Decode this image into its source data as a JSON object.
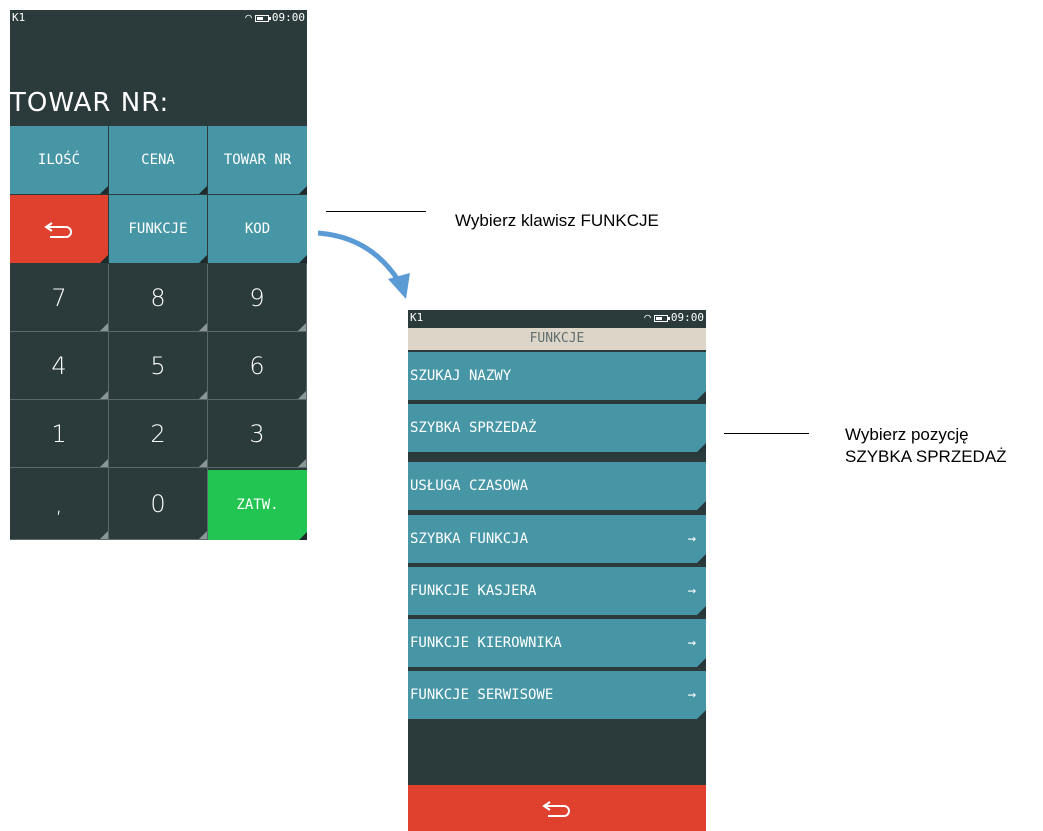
{
  "screen1": {
    "status_left": "K1",
    "status_time": "09:00",
    "prompt": "TOWAR NR:",
    "function_keys": [
      "ILOŚĆ",
      "CENA",
      "TOWAR NR",
      "FUNKCJE",
      "KOD"
    ],
    "keypad": [
      "7",
      "8",
      "9",
      "4",
      "5",
      "6",
      "1",
      "2",
      "3",
      ",",
      "0"
    ],
    "confirm_label": "ZATW."
  },
  "screen2": {
    "status_left": "K1",
    "status_time": "09:00",
    "title": "FUNKCJE",
    "menu": [
      {
        "label": "SZUKAJ NAZWY",
        "arrow": ""
      },
      {
        "label": "SZYBKA SPRZEDAŻ",
        "arrow": ""
      },
      {
        "label": "USŁUGA CZASOWA",
        "arrow": ""
      },
      {
        "label": "SZYBKA FUNKCJA",
        "arrow": "→"
      },
      {
        "label": "FUNKCJE KASJERA",
        "arrow": "→"
      },
      {
        "label": "FUNKCJE KIEROWNIKA",
        "arrow": "→"
      },
      {
        "label": "FUNKCJE SERWISOWE",
        "arrow": "→"
      }
    ]
  },
  "annotations": {
    "step1": "Wybierz klawisz FUNKCJE",
    "step2_line1": "Wybierz pozycję",
    "step2_line2": "SZYBKA SPRZEDAŻ"
  },
  "colors": {
    "screen_bg": "#2b3a3b",
    "teal": "#4796a6",
    "red": "#e0412f",
    "green": "#23c552",
    "title_bg": "#ddd6c8",
    "arrow": "#5b9bd5"
  }
}
